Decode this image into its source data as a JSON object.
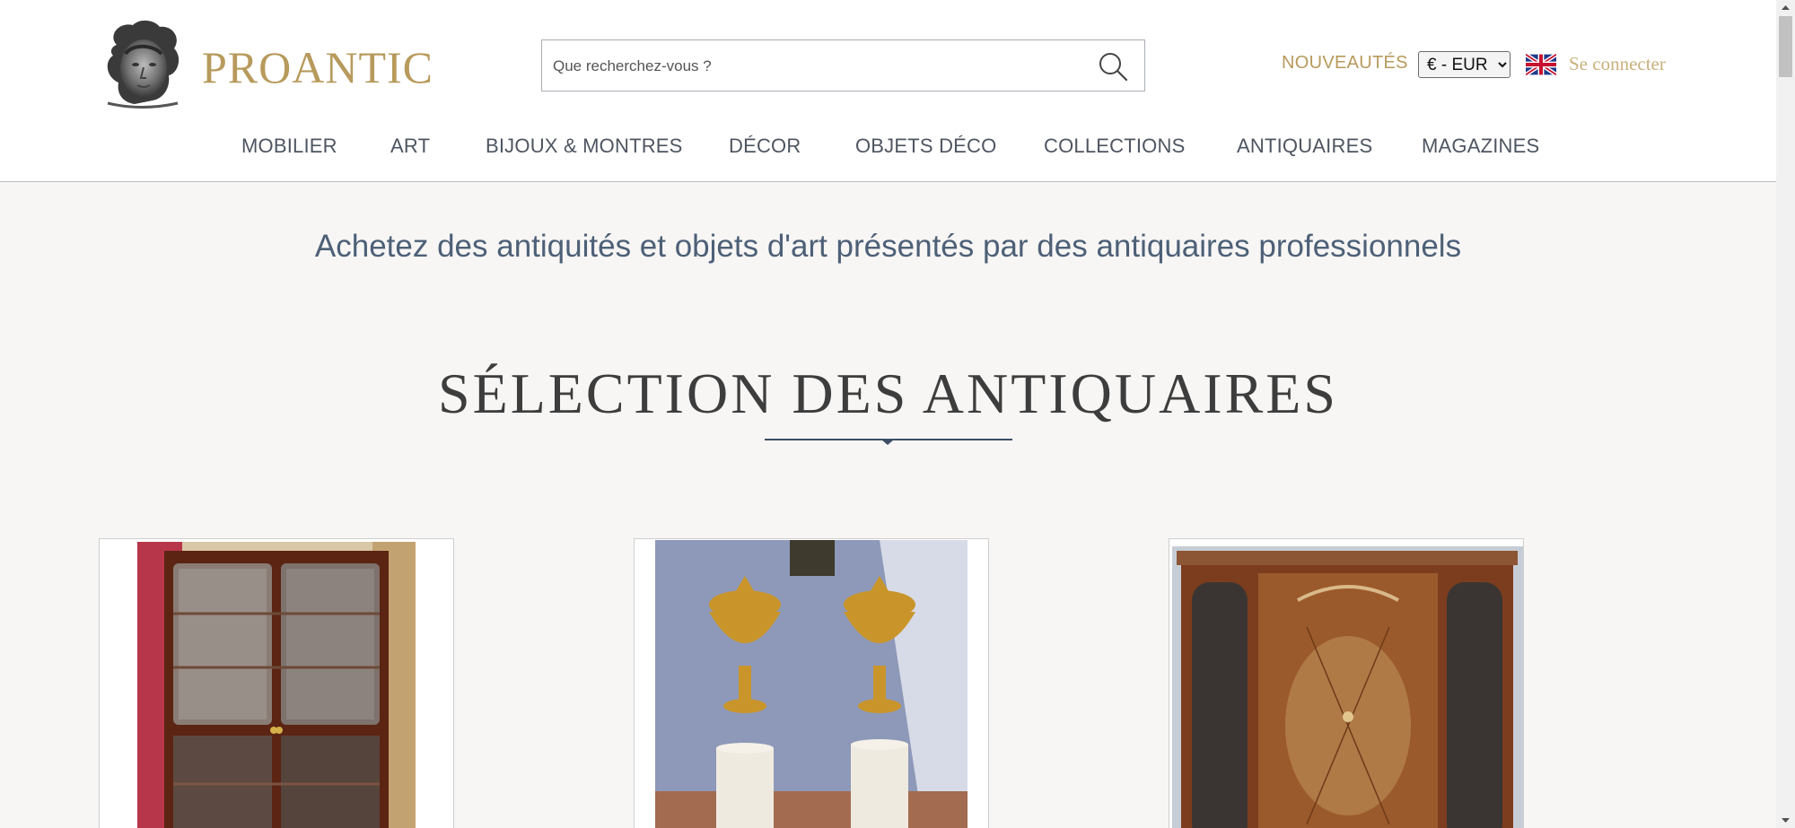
{
  "header": {
    "brand": "PROANTIC",
    "logo_icon": "sculpted-head-logo",
    "search": {
      "placeholder": "Que recherchez-vous ?",
      "value": "",
      "icon": "search-icon"
    },
    "new_link": "NOUVEAUTÉS",
    "currency": {
      "selected": "€ - EUR",
      "options": [
        "€ - EUR"
      ]
    },
    "language_icon": "uk-flag-icon",
    "login": "Se connecter"
  },
  "nav": {
    "items": [
      {
        "label": "MOBILIER"
      },
      {
        "label": "ART"
      },
      {
        "label": "BIJOUX & MONTRES"
      },
      {
        "label": "DÉCOR"
      },
      {
        "label": "OBJETS DÉCO"
      },
      {
        "label": "COLLECTIONS"
      },
      {
        "label": "ANTIQUAIRES"
      },
      {
        "label": "MAGAZINES"
      }
    ]
  },
  "main": {
    "tagline": "Achetez des antiquités et objets d'art présentés par des antiquaires professionnels",
    "section_title": "SÉLECTION DES ANTIQUAIRES"
  },
  "colors": {
    "brand_gold": "#b79a5c",
    "nav_text": "#4e5561",
    "tagline_blue": "#4d6077",
    "page_bg": "#f7f6f5"
  }
}
